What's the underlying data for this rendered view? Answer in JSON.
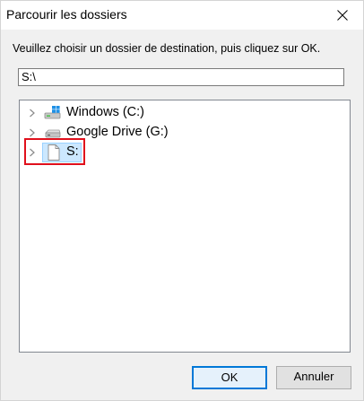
{
  "window": {
    "title": "Parcourir les dossiers",
    "close_icon": "close-icon"
  },
  "instruction": "Veuillez choisir un dossier de destination, puis cliquez sur OK.",
  "path_field": {
    "value": "S:\\"
  },
  "tree": {
    "items": [
      {
        "label": "Windows (C:)",
        "icon": "windows-drive-icon",
        "selected": false
      },
      {
        "label": "Google Drive (G:)",
        "icon": "drive-icon",
        "selected": false
      },
      {
        "label": "S:",
        "icon": "file-icon",
        "selected": true
      }
    ]
  },
  "buttons": {
    "ok_label": "OK",
    "cancel_label": "Annuler"
  },
  "colors": {
    "highlight": "#e0101c",
    "selection": "#cce8ff",
    "accent": "#0078d7"
  }
}
